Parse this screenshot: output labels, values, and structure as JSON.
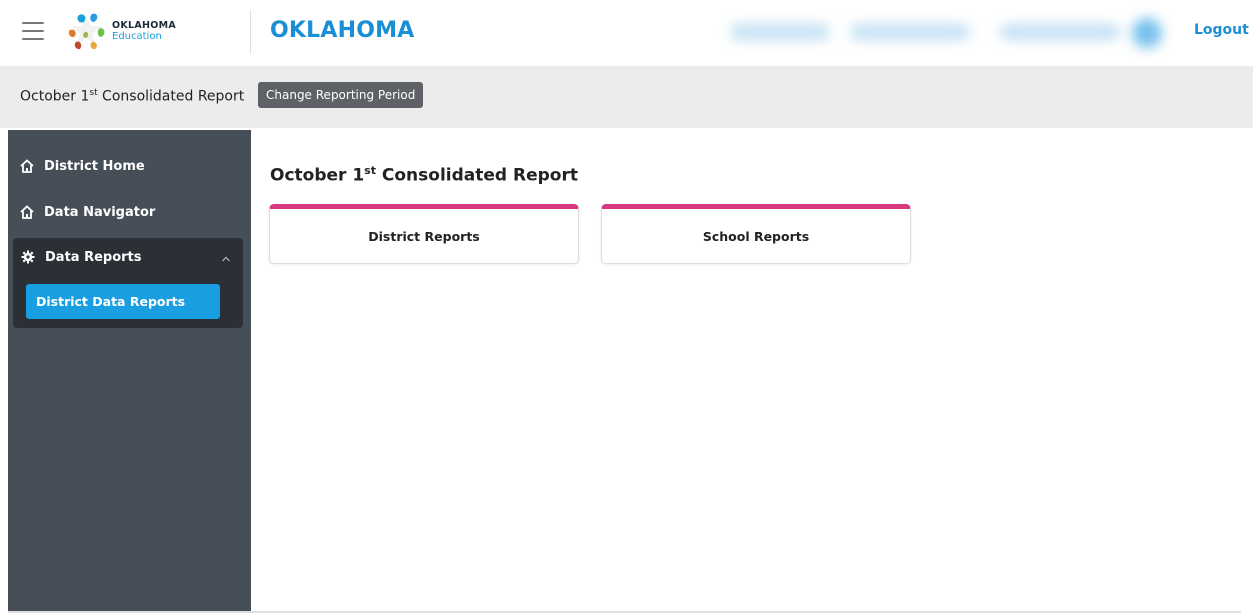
{
  "header": {
    "logo": {
      "line1": "OKLAHOMA",
      "line2": "Education"
    },
    "app_title": "OKLAHOMA",
    "logout_label": "Logout"
  },
  "subheader": {
    "report_title_pre": "October 1",
    "report_title_sup": "st",
    "report_title_post": " Consolidated Report",
    "change_button_label": "Change Reporting Period"
  },
  "sidebar": {
    "items": [
      {
        "label": "District Home",
        "icon": "home-icon"
      },
      {
        "label": "Data Navigator",
        "icon": "home-icon"
      },
      {
        "label": "Data Reports",
        "icon": "gear-icon",
        "expanded": true
      }
    ],
    "subitems": [
      {
        "label": "District Data Reports",
        "active": true
      }
    ]
  },
  "main": {
    "title_pre": "October 1",
    "title_sup": "st",
    "title_post": " Consolidated Report",
    "cards": [
      {
        "label": "District Reports"
      },
      {
        "label": "School Reports"
      }
    ]
  },
  "colors": {
    "brand_blue": "#1a8fd6",
    "accent_pink": "#d6397d",
    "sidebar_bg": "#464f57",
    "sidebar_panel": "#2b3036",
    "active_item": "#1a9ee2"
  }
}
